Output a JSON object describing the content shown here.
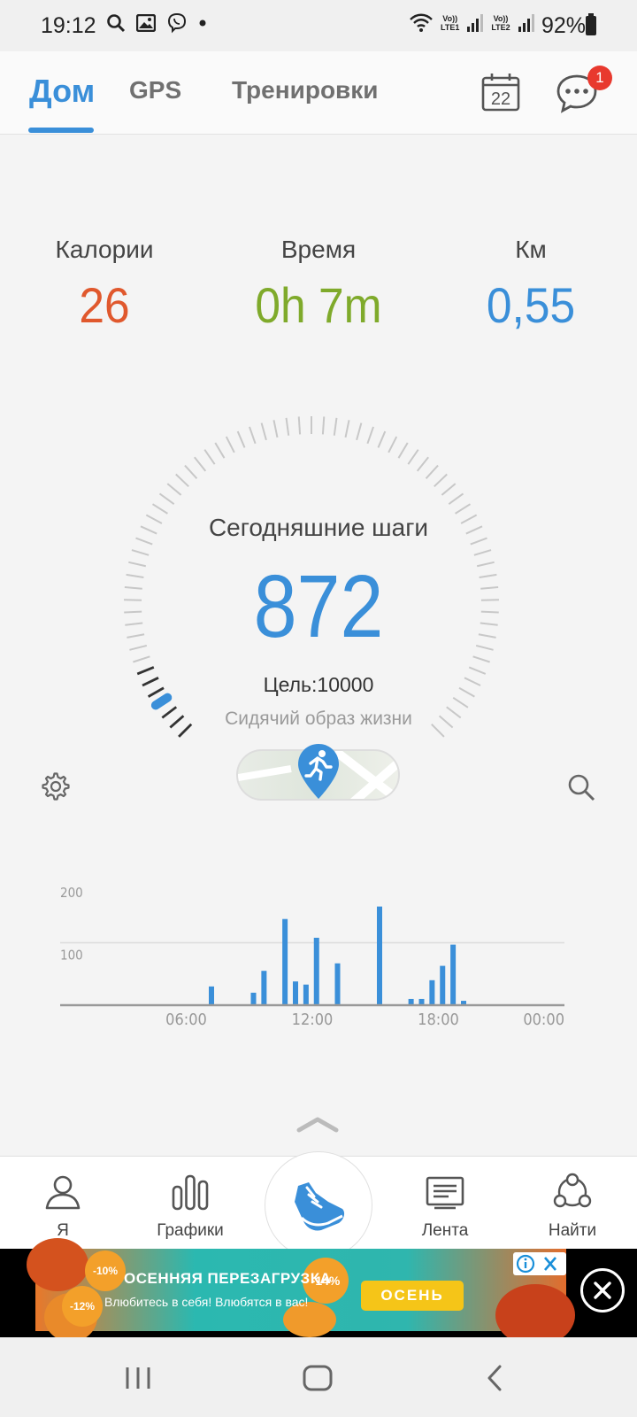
{
  "status_bar": {
    "time": "19:12",
    "battery": "92%",
    "lte1": "Vo)) LTE1",
    "lte2": "Vo)) LTE2"
  },
  "header": {
    "tabs": [
      {
        "label": "Дом",
        "active": true
      },
      {
        "label": "GPS",
        "active": false
      },
      {
        "label": "Тренировки",
        "active": false
      }
    ],
    "calendar_day": "22",
    "notifications_count": "1"
  },
  "stats": [
    {
      "label": "Калории",
      "value": "26",
      "color": "#e0582d"
    },
    {
      "label": "Время",
      "value": "0h 7m",
      "color": "#7faa2b"
    },
    {
      "label": "Км",
      "value": "0,55",
      "color": "#3a8fd9"
    }
  ],
  "steps": {
    "title": "Сегодняшние шаги",
    "value": "872",
    "goal_text": "Цель:10000",
    "status_text": "Сидячий образ жизни",
    "progress_fraction": 0.087
  },
  "chart_data": {
    "type": "bar",
    "x_tick_labels": [
      "06:00",
      "12:00",
      "18:00",
      "00:00"
    ],
    "y_tick_labels": [
      "100",
      "200"
    ],
    "ylim": [
      0,
      200
    ],
    "xlim_hours": [
      0,
      24
    ],
    "bar_color": "#3a8fd9",
    "bars": [
      {
        "hour": 7.2,
        "value": 30
      },
      {
        "hour": 9.2,
        "value": 20
      },
      {
        "hour": 9.7,
        "value": 55
      },
      {
        "hour": 10.7,
        "value": 138
      },
      {
        "hour": 11.2,
        "value": 38
      },
      {
        "hour": 11.7,
        "value": 33
      },
      {
        "hour": 12.2,
        "value": 108
      },
      {
        "hour": 13.2,
        "value": 67
      },
      {
        "hour": 15.2,
        "value": 158
      },
      {
        "hour": 16.7,
        "value": 10
      },
      {
        "hour": 17.2,
        "value": 10
      },
      {
        "hour": 17.7,
        "value": 40
      },
      {
        "hour": 18.2,
        "value": 63
      },
      {
        "hour": 18.7,
        "value": 97
      },
      {
        "hour": 19.2,
        "value": 7
      }
    ]
  },
  "bottom_nav": [
    {
      "label": "Я",
      "icon": "person-icon"
    },
    {
      "label": "Графики",
      "icon": "bar-chart-icon"
    },
    {
      "label": "",
      "icon": "sneaker-icon"
    },
    {
      "label": "Лента",
      "icon": "feed-icon"
    },
    {
      "label": "Найти",
      "icon": "people-icon"
    }
  ],
  "ad": {
    "title": "ОСЕННЯЯ ПЕРЕЗАГРУЗКА",
    "subtitle": "Влюбитесь в себя! Влюбятся в вас!",
    "button": "ОСЕНЬ",
    "badge_1": "-10%",
    "badge_2": "-14%",
    "badge_3": "-12%"
  }
}
